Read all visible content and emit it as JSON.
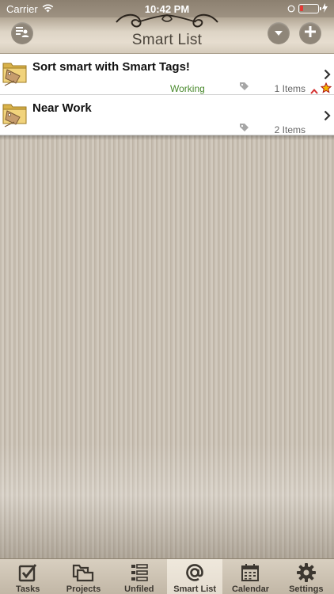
{
  "status_bar": {
    "carrier": "Carrier",
    "time": "10:42 PM"
  },
  "nav": {
    "title": "Smart List"
  },
  "rows": [
    {
      "title": "Sort smart with Smart Tags!",
      "status": "Working",
      "count": "1 Items",
      "icon": "folder-tag-icon"
    },
    {
      "title": "Near Work",
      "status": "",
      "count": "2 Items",
      "icon": "folder-tag-icon"
    }
  ],
  "tabs": [
    {
      "label": "Tasks",
      "icon": "checkbox-icon"
    },
    {
      "label": "Projects",
      "icon": "folders-icon"
    },
    {
      "label": "Unfiled",
      "icon": "list-icon"
    },
    {
      "label": "Smart List",
      "icon": "at-icon"
    },
    {
      "label": "Calendar",
      "icon": "calendar-icon"
    },
    {
      "label": "Settings",
      "icon": "gear-icon"
    }
  ],
  "colors": {
    "status_working": "#4a8a2e",
    "priority": "#d32f2f",
    "star": "#f2b600"
  }
}
